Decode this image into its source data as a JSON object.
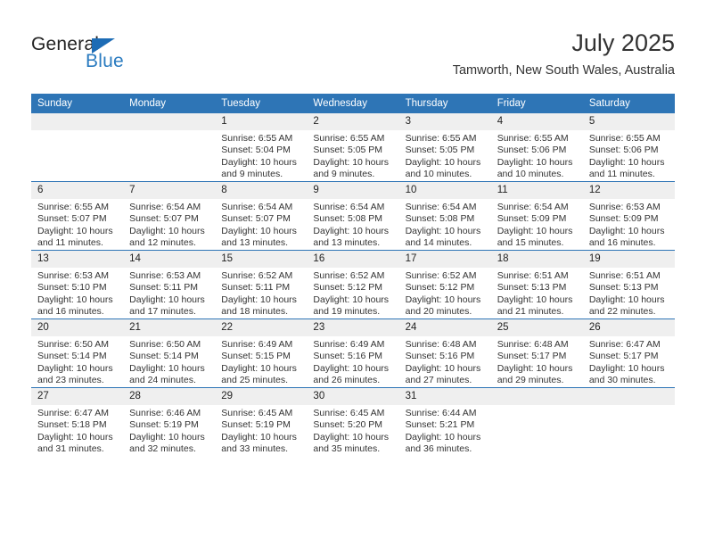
{
  "brand": {
    "name_part1": "General",
    "name_part2": "Blue",
    "triangle_icon": "triangle-icon",
    "accent_color": "#2a7bc0"
  },
  "header": {
    "month_title": "July 2025",
    "location": "Tamworth, New South Wales, Australia"
  },
  "calendar": {
    "header_bg": "#2e75b6",
    "daynum_bg": "#efefef",
    "weekday_headers": [
      "Sunday",
      "Monday",
      "Tuesday",
      "Wednesday",
      "Thursday",
      "Friday",
      "Saturday"
    ],
    "weeks": [
      [
        {
          "day": "",
          "lines": []
        },
        {
          "day": "",
          "lines": []
        },
        {
          "day": "1",
          "lines": [
            "Sunrise: 6:55 AM",
            "Sunset: 5:04 PM",
            "Daylight: 10 hours",
            "and 9 minutes."
          ]
        },
        {
          "day": "2",
          "lines": [
            "Sunrise: 6:55 AM",
            "Sunset: 5:05 PM",
            "Daylight: 10 hours",
            "and 9 minutes."
          ]
        },
        {
          "day": "3",
          "lines": [
            "Sunrise: 6:55 AM",
            "Sunset: 5:05 PM",
            "Daylight: 10 hours",
            "and 10 minutes."
          ]
        },
        {
          "day": "4",
          "lines": [
            "Sunrise: 6:55 AM",
            "Sunset: 5:06 PM",
            "Daylight: 10 hours",
            "and 10 minutes."
          ]
        },
        {
          "day": "5",
          "lines": [
            "Sunrise: 6:55 AM",
            "Sunset: 5:06 PM",
            "Daylight: 10 hours",
            "and 11 minutes."
          ]
        }
      ],
      [
        {
          "day": "6",
          "lines": [
            "Sunrise: 6:55 AM",
            "Sunset: 5:07 PM",
            "Daylight: 10 hours",
            "and 11 minutes."
          ]
        },
        {
          "day": "7",
          "lines": [
            "Sunrise: 6:54 AM",
            "Sunset: 5:07 PM",
            "Daylight: 10 hours",
            "and 12 minutes."
          ]
        },
        {
          "day": "8",
          "lines": [
            "Sunrise: 6:54 AM",
            "Sunset: 5:07 PM",
            "Daylight: 10 hours",
            "and 13 minutes."
          ]
        },
        {
          "day": "9",
          "lines": [
            "Sunrise: 6:54 AM",
            "Sunset: 5:08 PM",
            "Daylight: 10 hours",
            "and 13 minutes."
          ]
        },
        {
          "day": "10",
          "lines": [
            "Sunrise: 6:54 AM",
            "Sunset: 5:08 PM",
            "Daylight: 10 hours",
            "and 14 minutes."
          ]
        },
        {
          "day": "11",
          "lines": [
            "Sunrise: 6:54 AM",
            "Sunset: 5:09 PM",
            "Daylight: 10 hours",
            "and 15 minutes."
          ]
        },
        {
          "day": "12",
          "lines": [
            "Sunrise: 6:53 AM",
            "Sunset: 5:09 PM",
            "Daylight: 10 hours",
            "and 16 minutes."
          ]
        }
      ],
      [
        {
          "day": "13",
          "lines": [
            "Sunrise: 6:53 AM",
            "Sunset: 5:10 PM",
            "Daylight: 10 hours",
            "and 16 minutes."
          ]
        },
        {
          "day": "14",
          "lines": [
            "Sunrise: 6:53 AM",
            "Sunset: 5:11 PM",
            "Daylight: 10 hours",
            "and 17 minutes."
          ]
        },
        {
          "day": "15",
          "lines": [
            "Sunrise: 6:52 AM",
            "Sunset: 5:11 PM",
            "Daylight: 10 hours",
            "and 18 minutes."
          ]
        },
        {
          "day": "16",
          "lines": [
            "Sunrise: 6:52 AM",
            "Sunset: 5:12 PM",
            "Daylight: 10 hours",
            "and 19 minutes."
          ]
        },
        {
          "day": "17",
          "lines": [
            "Sunrise: 6:52 AM",
            "Sunset: 5:12 PM",
            "Daylight: 10 hours",
            "and 20 minutes."
          ]
        },
        {
          "day": "18",
          "lines": [
            "Sunrise: 6:51 AM",
            "Sunset: 5:13 PM",
            "Daylight: 10 hours",
            "and 21 minutes."
          ]
        },
        {
          "day": "19",
          "lines": [
            "Sunrise: 6:51 AM",
            "Sunset: 5:13 PM",
            "Daylight: 10 hours",
            "and 22 minutes."
          ]
        }
      ],
      [
        {
          "day": "20",
          "lines": [
            "Sunrise: 6:50 AM",
            "Sunset: 5:14 PM",
            "Daylight: 10 hours",
            "and 23 minutes."
          ]
        },
        {
          "day": "21",
          "lines": [
            "Sunrise: 6:50 AM",
            "Sunset: 5:14 PM",
            "Daylight: 10 hours",
            "and 24 minutes."
          ]
        },
        {
          "day": "22",
          "lines": [
            "Sunrise: 6:49 AM",
            "Sunset: 5:15 PM",
            "Daylight: 10 hours",
            "and 25 minutes."
          ]
        },
        {
          "day": "23",
          "lines": [
            "Sunrise: 6:49 AM",
            "Sunset: 5:16 PM",
            "Daylight: 10 hours",
            "and 26 minutes."
          ]
        },
        {
          "day": "24",
          "lines": [
            "Sunrise: 6:48 AM",
            "Sunset: 5:16 PM",
            "Daylight: 10 hours",
            "and 27 minutes."
          ]
        },
        {
          "day": "25",
          "lines": [
            "Sunrise: 6:48 AM",
            "Sunset: 5:17 PM",
            "Daylight: 10 hours",
            "and 29 minutes."
          ]
        },
        {
          "day": "26",
          "lines": [
            "Sunrise: 6:47 AM",
            "Sunset: 5:17 PM",
            "Daylight: 10 hours",
            "and 30 minutes."
          ]
        }
      ],
      [
        {
          "day": "27",
          "lines": [
            "Sunrise: 6:47 AM",
            "Sunset: 5:18 PM",
            "Daylight: 10 hours",
            "and 31 minutes."
          ]
        },
        {
          "day": "28",
          "lines": [
            "Sunrise: 6:46 AM",
            "Sunset: 5:19 PM",
            "Daylight: 10 hours",
            "and 32 minutes."
          ]
        },
        {
          "day": "29",
          "lines": [
            "Sunrise: 6:45 AM",
            "Sunset: 5:19 PM",
            "Daylight: 10 hours",
            "and 33 minutes."
          ]
        },
        {
          "day": "30",
          "lines": [
            "Sunrise: 6:45 AM",
            "Sunset: 5:20 PM",
            "Daylight: 10 hours",
            "and 35 minutes."
          ]
        },
        {
          "day": "31",
          "lines": [
            "Sunrise: 6:44 AM",
            "Sunset: 5:21 PM",
            "Daylight: 10 hours",
            "and 36 minutes."
          ]
        },
        {
          "day": "",
          "lines": []
        },
        {
          "day": "",
          "lines": []
        }
      ]
    ]
  }
}
